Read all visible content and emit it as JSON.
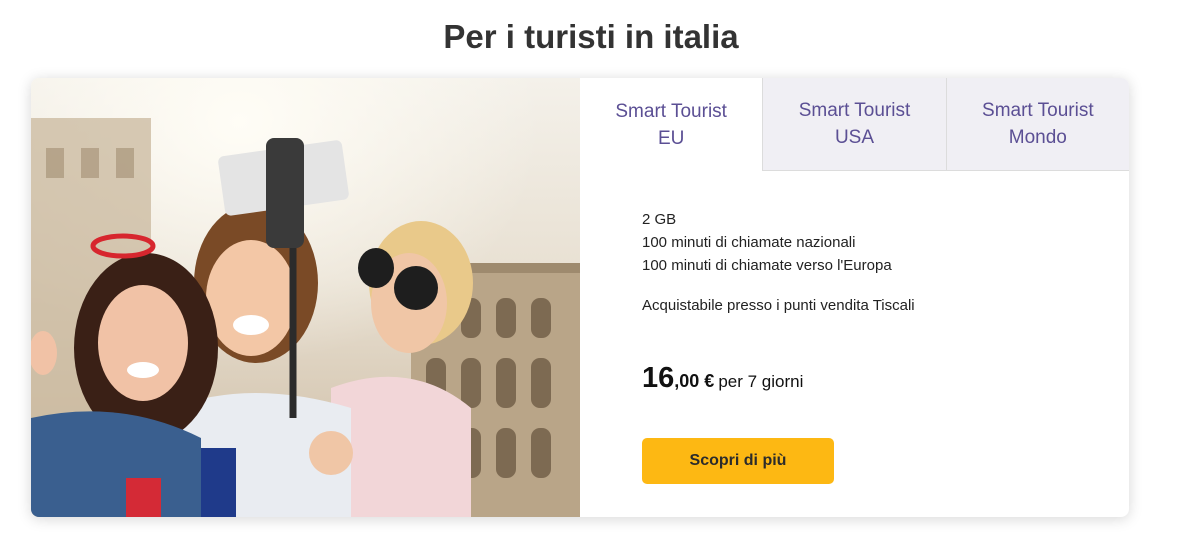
{
  "header": {
    "title": "Per i turisti in italia"
  },
  "tabs": [
    {
      "label": "Smart Tourist\nEU",
      "active": true
    },
    {
      "label": "Smart Tourist\nUSA",
      "active": false
    },
    {
      "label": "Smart Tourist\nMondo",
      "active": false
    }
  ],
  "offer": {
    "features": [
      "2 GB",
      "100 minuti di chiamate nazionali",
      "100 minuti di chiamate verso l'Europa"
    ],
    "availability": "Acquistabile presso i punti vendita Tiscali",
    "price_int": "16",
    "price_dec": ",00 €",
    "price_period": "per 7 giorni",
    "cta_label": "Scopri di più"
  },
  "colors": {
    "accent": "#fdb813",
    "tab_text": "#5b4f94",
    "tab_inactive_bg": "#f0eff4"
  }
}
